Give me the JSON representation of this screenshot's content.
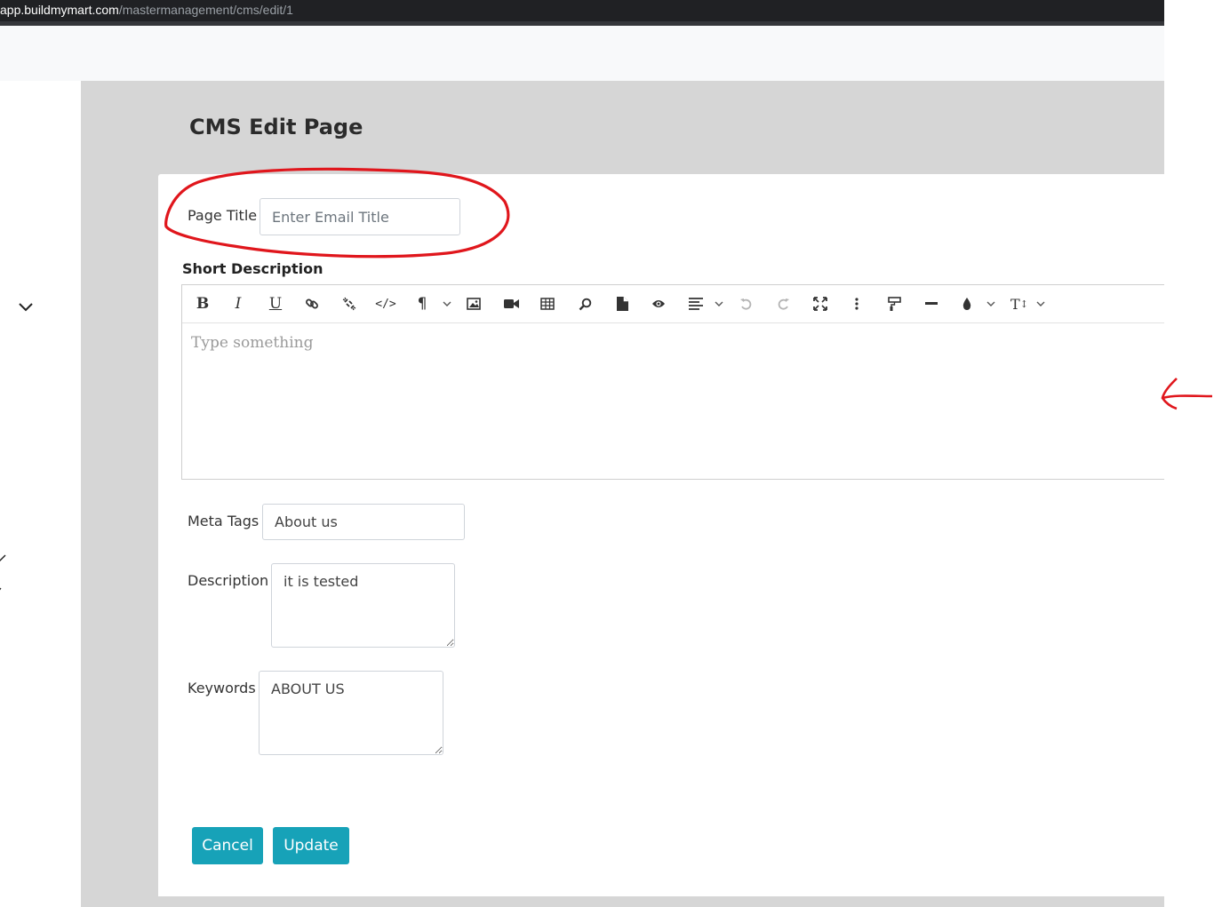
{
  "browser": {
    "url_host": "app.buildmymart.com",
    "url_path": "/mastermanagement/cms/edit/1"
  },
  "page": {
    "title": "CMS Edit Page"
  },
  "form": {
    "page_title_label": "Page Title",
    "page_title_placeholder": "Enter Email Title",
    "short_description_label": "Short Description",
    "editor_placeholder": "Type something",
    "meta_tags_label": "Meta Tags",
    "meta_tags_value": "About us",
    "description_label": "Description",
    "description_value": "it is tested",
    "keywords_label": "Keywords",
    "keywords_value": "ABOUT US",
    "cancel_label": "Cancel",
    "update_label": "Update"
  },
  "toolbar_items": [
    "bold-icon",
    "italic-icon",
    "underline-icon",
    "link-icon",
    "unlink-icon",
    "code-view-icon",
    "paragraph-icon",
    "image-icon",
    "video-icon",
    "table-icon",
    "search-icon",
    "file-icon",
    "preview-icon",
    "align-icon",
    "undo-icon",
    "redo-icon",
    "fullscreen-icon",
    "more-icon",
    "format-painter-icon",
    "horizontal-rule-icon",
    "text-color-icon",
    "font-size-icon"
  ],
  "colors": {
    "accent": "#17a2b8",
    "annotation": "#e0161c",
    "content_bg": "#d6d6d6"
  }
}
